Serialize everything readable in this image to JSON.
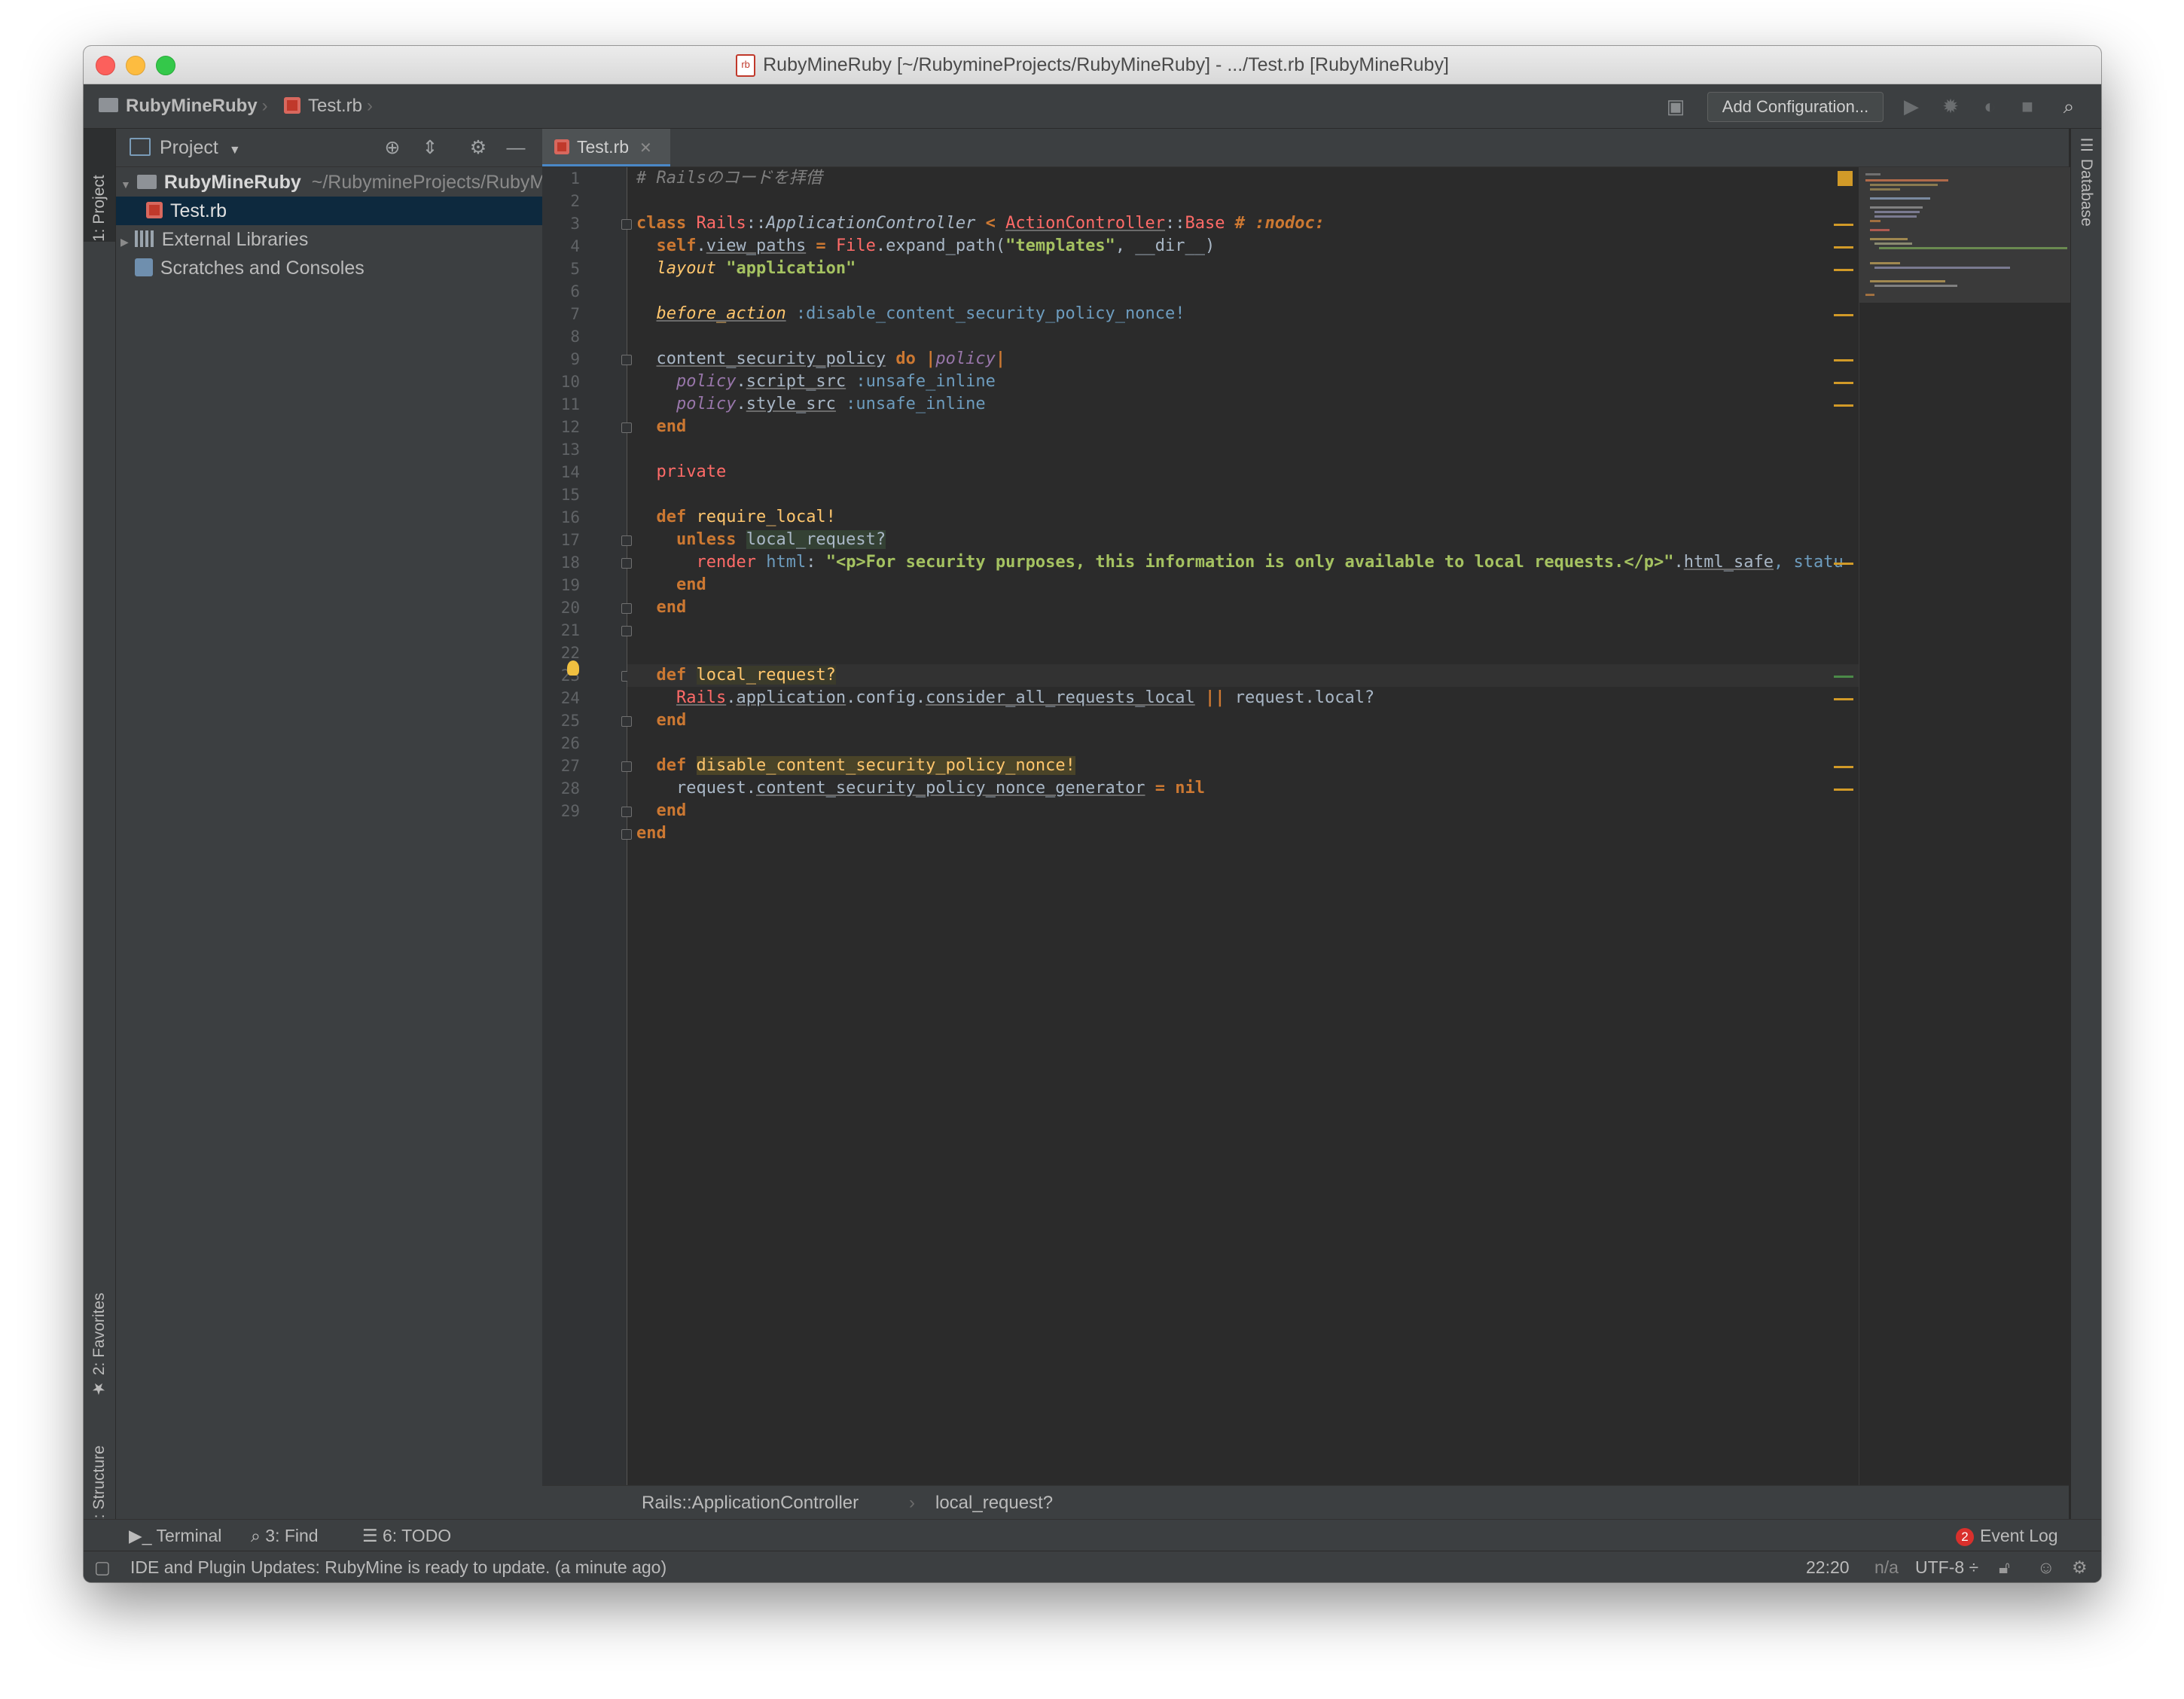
{
  "window": {
    "title": "RubyMineRuby [~/RubymineProjects/RubyMineRuby] - .../Test.rb [RubyMineRuby]",
    "title_icon": "rb"
  },
  "navbar": {
    "project": "RubyMineRuby",
    "file": "Test.rb",
    "add_configuration": "Add Configuration..."
  },
  "left_tabs": {
    "project": "1: Project",
    "favorites": "2: Favorites",
    "structure": "Z: Structure"
  },
  "right_tabs": {
    "database": "Database"
  },
  "project_panel": {
    "title": "Project",
    "tree": {
      "root_name": "RubyMineRuby",
      "root_path": "~/RubymineProjects/RubyMineRuby",
      "file": "Test.rb",
      "external_libraries": "External Libraries",
      "scratches": "Scratches and Consoles"
    }
  },
  "editor": {
    "tab_label": "Test.rb",
    "line_numbers": [
      "1",
      "2",
      "3",
      "4",
      "5",
      "6",
      "7",
      "8",
      "9",
      "10",
      "11",
      "12",
      "13",
      "14",
      "15",
      "16",
      "17",
      "18",
      "19",
      "20",
      "21",
      "22",
      "23",
      "24",
      "25",
      "26",
      "27",
      "28",
      "29"
    ],
    "code": {
      "l1_comment": "# Railsのコードを拝借",
      "l3_class": "class",
      "l3_rails": "Rails",
      "l3_sep1": "::",
      "l3_appctrl": "ApplicationController",
      "l3_lt": " < ",
      "l3_actionctrl": "ActionController",
      "l3_sep2": "::",
      "l3_base": "Base",
      "l3_nodoc": " # :nodoc:",
      "l4_self": "self",
      "l4_dot": ".",
      "l4_view_paths": "view_paths",
      "l4_eq": " = ",
      "l4_file": "File",
      "l4_expand": ".expand_path(",
      "l4_str": "\"templates\"",
      "l4_rest": ", __dir__)",
      "l5_layout": "layout",
      "l5_str": " \"application\"",
      "l7_before": "before_action",
      "l7_sym": " :disable_content_security_policy_nonce!",
      "l9_csp": "content_security_policy",
      "l9_do": " do ",
      "l9_pipe1": "|",
      "l9_policy": "policy",
      "l9_pipe2": "|",
      "l10_policy": "policy",
      "l10_dot": ".",
      "l10_script": "script_src",
      "l10_sym": " :unsafe_inline",
      "l11_policy": "policy",
      "l11_dot": ".",
      "l11_style": "style_src",
      "l11_sym": " :unsafe_inline",
      "l12_end": "end",
      "l14_private": "private",
      "l16_def": "def",
      "l16_name": " require_local!",
      "l17_unless": "unless",
      "l17_call": "local_request?",
      "l18_render": "render",
      "l18_html": " html",
      "l18_colon": ": ",
      "l18_str": "\"<p>For security purposes, this information is only available to local requests.</p>\"",
      "l18_dot": ".",
      "l18_safe": "html_safe",
      "l18_rest": ", statu",
      "l19_end": "end",
      "l20_end": "end",
      "l22_def": "def",
      "l22_name": "local_request?",
      "l23_rails": "Rails",
      "l23_dot1": ".",
      "l23_app": "application",
      "l23_cfg": ".config.",
      "l23_consider": "consider_all_requests_local",
      "l23_or": " || ",
      "l23_req": "request.local?",
      "l24_end": "end",
      "l26_def": "def",
      "l26_name": "disable_content_security_policy_nonce!",
      "l27_req": "request.",
      "l27_gen": "content_security_policy_nonce_generator",
      "l27_eq": " = ",
      "l27_nil": "nil",
      "l28_end": "end",
      "l29_end": "end"
    }
  },
  "breadcrumb": {
    "class": "Rails::ApplicationController",
    "method": "local_request?"
  },
  "bottom_tools": {
    "terminal": "Terminal",
    "find": "3: Find",
    "todo": "6: TODO",
    "event_log": "Event Log",
    "event_count": "2"
  },
  "status": {
    "message": "IDE and Plugin Updates: RubyMine is ready to update. (a minute ago)",
    "position": "22:20",
    "na": "n/a",
    "encoding": "UTF-8 ÷"
  },
  "colors": {
    "editor_bg": "#2b2b2b",
    "panel_bg": "#3c3f41",
    "selection": "#0d293e",
    "keyword": "#cc7832",
    "string": "#a5c261"
  }
}
